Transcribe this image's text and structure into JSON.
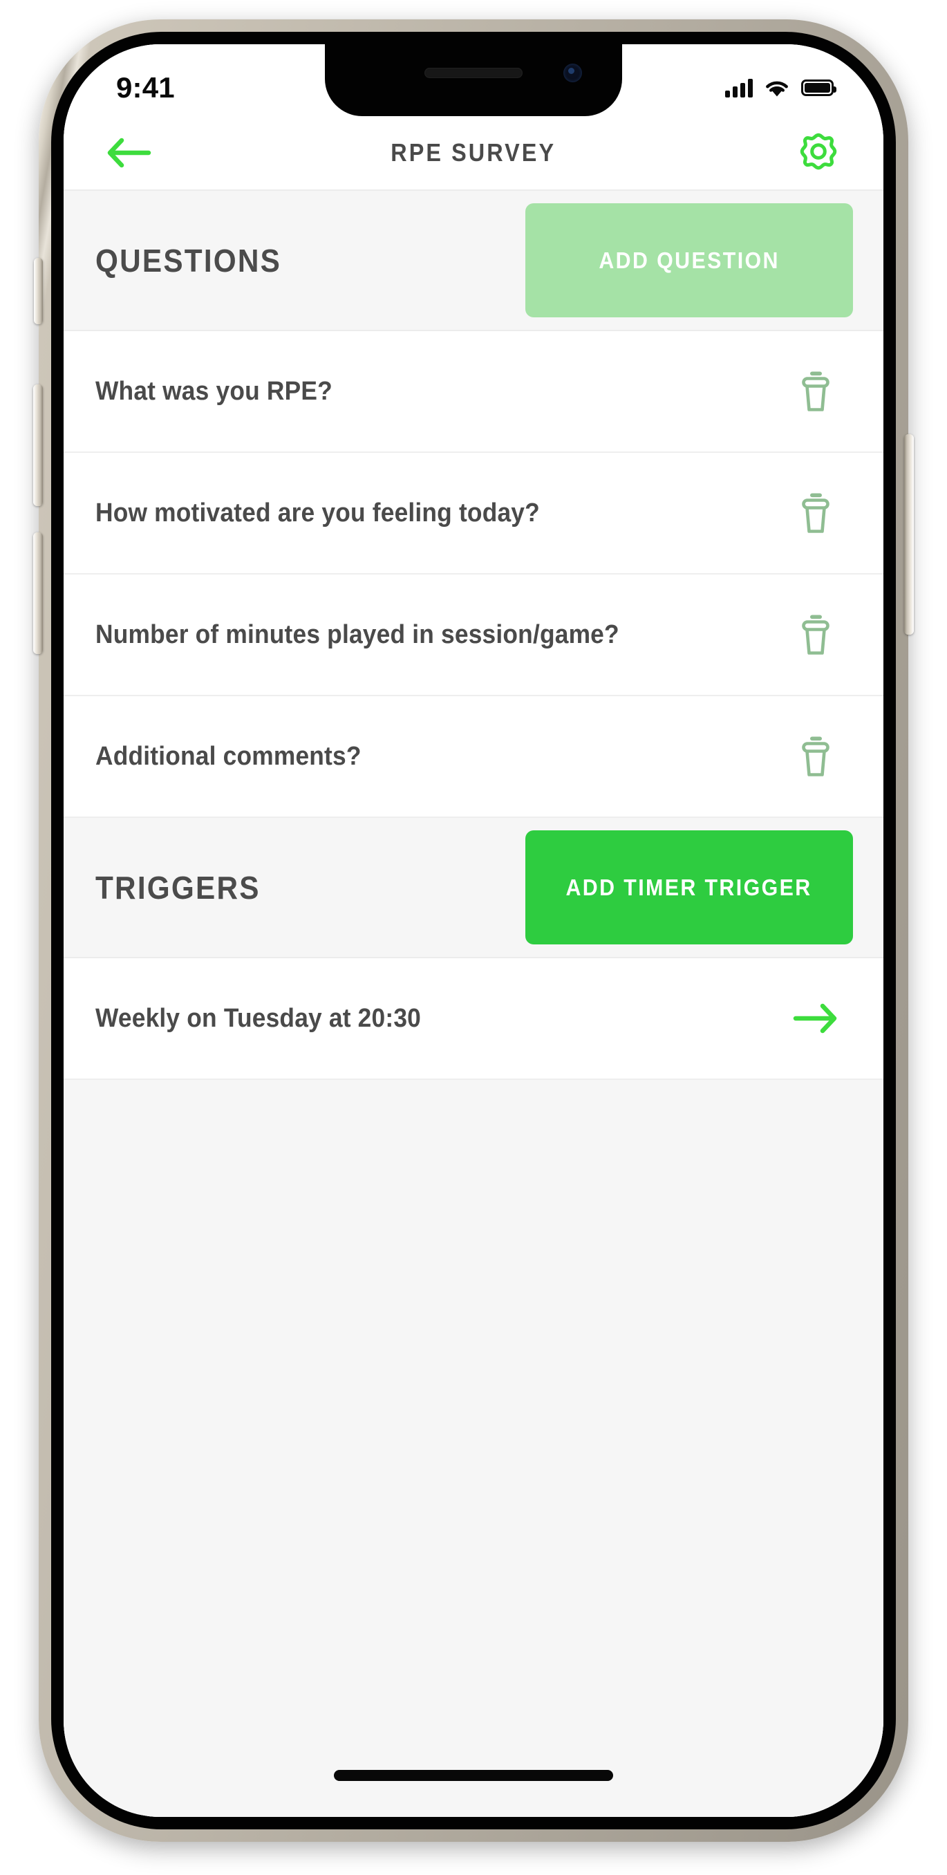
{
  "status_bar": {
    "time": "9:41",
    "cellular_icon": "signal-bars-icon",
    "wifi_icon": "wifi-icon",
    "battery_icon": "battery-full-icon"
  },
  "header": {
    "back_icon": "arrow-left-icon",
    "title": "RPE SURVEY",
    "settings_icon": "gear-icon"
  },
  "questions_section": {
    "title": "QUESTIONS",
    "add_button_label": "ADD QUESTION",
    "add_button_color": "#a5e2a6",
    "items": [
      {
        "label": "What was you RPE?",
        "action_icon": "trash-icon"
      },
      {
        "label": "How motivated are you feeling today?",
        "action_icon": "trash-icon"
      },
      {
        "label": "Number of minutes played in session/game?",
        "action_icon": "trash-icon"
      },
      {
        "label": "Additional comments?",
        "action_icon": "trash-icon"
      }
    ]
  },
  "triggers_section": {
    "title": "TRIGGERS",
    "add_button_label": "ADD TIMER TRIGGER",
    "add_button_color": "#2ecc40",
    "items": [
      {
        "label": "Weekly on Tuesday at 20:30",
        "action_icon": "arrow-right-icon"
      }
    ]
  },
  "colors": {
    "accent_green": "#3ddc3d",
    "accent_green_muted": "#8fbd92",
    "text_primary": "#4a4a4a",
    "section_bg": "#f6f6f6",
    "row_bg": "#ffffff"
  }
}
